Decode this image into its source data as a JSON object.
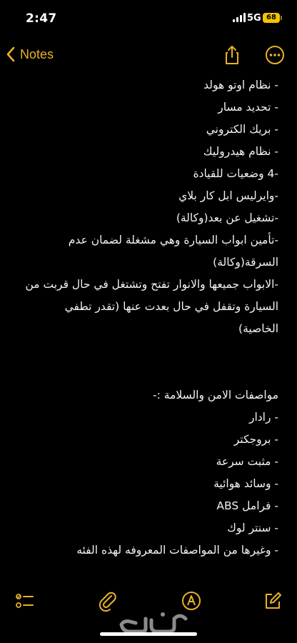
{
  "status_bar": {
    "time": "2:47",
    "network": "5G",
    "battery": "68",
    "battery_color": "#f5c400"
  },
  "nav": {
    "back_label": "Notes",
    "accent": "#e8b22a",
    "share_icon": "share-icon",
    "more_icon": "ellipsis-circle-icon"
  },
  "note": {
    "lines": [
      "- نظام اوتو هولد",
      "- تحديد مسار",
      "- بريك الكتروني",
      "- نظام هيدروليك",
      "-4 وضعيات للقيادة",
      "-وايرليس ابل كار بلاي",
      "-تشغيل عن بعد(وكالة)",
      "-تأمين ابواب السيارة وهي مشغلة لضمان عدم السرقة(وكالة)",
      "-الابواب جميعها والانوار تفتح وتشتغل في حال قربت من السيارة وتقفل في حال بعدت عنها (تقدر تطفي الخاصية)",
      "",
      "",
      "مواصفات الامن والسلامة :-",
      "- رادار",
      "- بروجكتر",
      "- مثبت سرعة",
      "- وسائد هوائية",
      "- فرامل ABS",
      "- سنتر لوك",
      "- وغيرها من المواصفات المعروفه لهذه الفئه"
    ]
  },
  "toolbar": {
    "icons": [
      "checklist-icon",
      "paperclip-icon",
      "markup-pen-icon",
      "compose-icon"
    ]
  },
  "watermark": {
    "text": "حراج"
  }
}
